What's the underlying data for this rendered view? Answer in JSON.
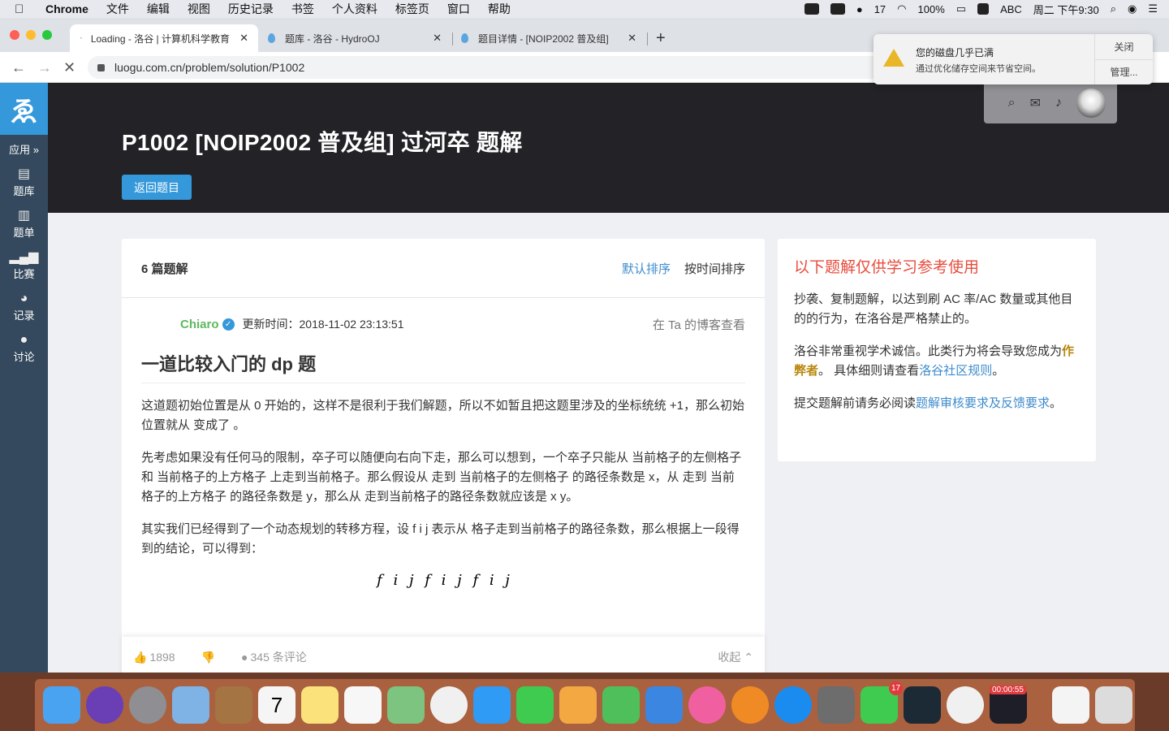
{
  "menubar": {
    "app": "Chrome",
    "items": [
      "文件",
      "编辑",
      "视图",
      "历史记录",
      "书签",
      "个人资料",
      "标签页",
      "窗口",
      "帮助"
    ],
    "status": {
      "wechat_count": "17",
      "battery": "100%",
      "input": "ABC",
      "datetime": "周二 下午9:30"
    }
  },
  "browser": {
    "tabs": [
      {
        "title": "Loading - 洛谷 | 计算机科学教育",
        "active": true
      },
      {
        "title": "题库 - 洛谷 - HydroOJ",
        "active": false
      },
      {
        "title": "题目详情 - [NOIP2002 普及组]",
        "active": false
      }
    ],
    "url": "luogu.com.cn/problem/solution/P1002"
  },
  "notification": {
    "title": "您的磁盘几乎已满",
    "subtitle": "通过优化储存空间来节省空间。",
    "close_label": "关闭",
    "manage_label": "管理..."
  },
  "sidebar": {
    "apps_label": "应用 »",
    "items": [
      {
        "label": "题库",
        "icon": "book-icon"
      },
      {
        "label": "题单",
        "icon": "clipboard-icon"
      },
      {
        "label": "比赛",
        "icon": "bar-chart-icon"
      },
      {
        "label": "记录",
        "icon": "pie-chart-icon"
      },
      {
        "label": "讨论",
        "icon": "comments-icon"
      }
    ]
  },
  "header": {
    "title": "P1002 [NOIP2002 普及组] 过河卒 题解",
    "back_button": "返回题目"
  },
  "solutions": {
    "count_label": "6 篇题解",
    "sort_default": "默认排序",
    "sort_time": "按时间排序",
    "author": "Chiaro",
    "updated": "更新时间：2018-11-02 23:13:51",
    "blog_link": "在 Ta 的博客查看",
    "article_title": "一道比较入门的 dp 题",
    "paragraphs": [
      "这道题初始位置是从 0 开始的，这样不是很利于我们解题，所以不如暂且把这题里涉及的坐标统统 +1，那么初始位置就从          变成了          。",
      "先考虑如果没有任何马的限制，卒子可以随便向右向下走，那么可以想到，一个卒子只能从 当前格子的左侧格子 和 当前格子的上方格子 上走到当前格子。那么假设从          走到 当前格子的左侧格子 的路径条数是 x，从          走到 当前格子的上方格子 的路径条数是 y，那么从          走到当前格子的路径条数就应该是 x    y。",
      "其实我们已经得到了一个动态规划的转移方程，设 f i j  表示从          格子走到当前格子的路径条数，那么根据上一段得到的结论，可以得到："
    ],
    "equation": "f i j    f i    j   f i j",
    "likes": "1898",
    "comments": "345 条评论",
    "collapse": "收起"
  },
  "notice": {
    "title": "以下题解仅供学习参考使用",
    "p1": "抄袭、复制题解，以达到刷 AC 率/AC 数量或其他目的的行为，在洛谷是严格禁止的。",
    "p2_a": "洛谷非常重视学术诚信。此类行为将会导致您成为",
    "p2_cheater": "作弊者",
    "p2_b": "。 具体细则请查看",
    "p2_link": "洛谷社区规则",
    "p2_c": "。",
    "p3_a": "提交题解前请务必阅读",
    "p3_link": "题解审核要求及反馈要求",
    "p3_b": "。"
  },
  "dock": {
    "apps": [
      {
        "name": "finder",
        "color": "#4aa3f0"
      },
      {
        "name": "siri",
        "color": "#6a3fb5"
      },
      {
        "name": "launchpad",
        "color": "#8e8e93"
      },
      {
        "name": "mail",
        "color": "#7fb3e6"
      },
      {
        "name": "contacts",
        "color": "#a47443"
      },
      {
        "name": "calendar",
        "color": "#f5f5f5",
        "text": "7"
      },
      {
        "name": "notes",
        "color": "#fbe27a"
      },
      {
        "name": "reminders",
        "color": "#f7f7f7"
      },
      {
        "name": "maps",
        "color": "#7cc47f"
      },
      {
        "name": "photos",
        "color": "#f0f0f0"
      },
      {
        "name": "messages",
        "color": "#2f9bf5"
      },
      {
        "name": "facetime",
        "color": "#3fcb4f"
      },
      {
        "name": "pages",
        "color": "#f3a842"
      },
      {
        "name": "numbers",
        "color": "#4fbf5c"
      },
      {
        "name": "keynote",
        "color": "#3b86e0"
      },
      {
        "name": "itunes",
        "color": "#f060a0"
      },
      {
        "name": "books",
        "color": "#f08a24"
      },
      {
        "name": "app-store",
        "color": "#1a8cf0"
      },
      {
        "name": "system-preferences",
        "color": "#6d6d6d"
      },
      {
        "name": "wechat",
        "color": "#3fcb4f",
        "badge": "17"
      },
      {
        "name": "feishu",
        "color": "#1c2a36"
      },
      {
        "name": "chrome",
        "color": "#f0f0f0"
      },
      {
        "name": "screen-recorder",
        "color": "#1e1e28",
        "rec": "00:00:55"
      },
      {
        "name": "document",
        "color": "#f4f4f4"
      },
      {
        "name": "trash",
        "color": "#dcdcdc"
      }
    ]
  }
}
